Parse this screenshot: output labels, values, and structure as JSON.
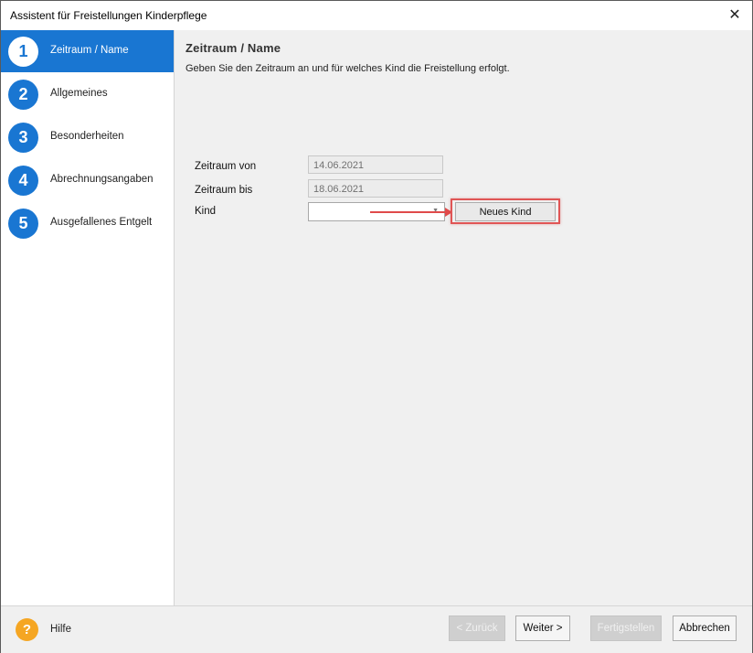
{
  "window": {
    "title": "Assistent für Freistellungen Kinderpflege",
    "close_glyph": "✕"
  },
  "sidebar": {
    "steps": [
      {
        "number": "1",
        "label": "Zeitraum / Name",
        "active": true
      },
      {
        "number": "2",
        "label": "Allgemeines",
        "active": false
      },
      {
        "number": "3",
        "label": "Besonderheiten",
        "active": false
      },
      {
        "number": "4",
        "label": "Abrechnungsangaben",
        "active": false
      },
      {
        "number": "5",
        "label": "Ausgefallenes Entgelt",
        "active": false
      }
    ]
  },
  "main": {
    "title": "Zeitraum / Name",
    "description": "Geben Sie den Zeitraum an und für welches Kind die Freistellung erfolgt.",
    "fields": {
      "von": {
        "label": "Zeitraum von",
        "value": "14.06.2021"
      },
      "bis": {
        "label": "Zeitraum bis",
        "value": "18.06.2021"
      },
      "kind": {
        "label": "Kind",
        "value": "",
        "arrow": "▼"
      }
    },
    "neues_kind_label": "Neues Kind"
  },
  "footer": {
    "help_glyph": "?",
    "help_label": "Hilfe",
    "back_label": "< Zurück",
    "next_label": "Weiter >",
    "finish_label": "Fertigstellen",
    "cancel_label": "Abbrechen"
  },
  "colors": {
    "accent": "#1976d2",
    "highlight": "#e05555",
    "help": "#f5a623"
  }
}
